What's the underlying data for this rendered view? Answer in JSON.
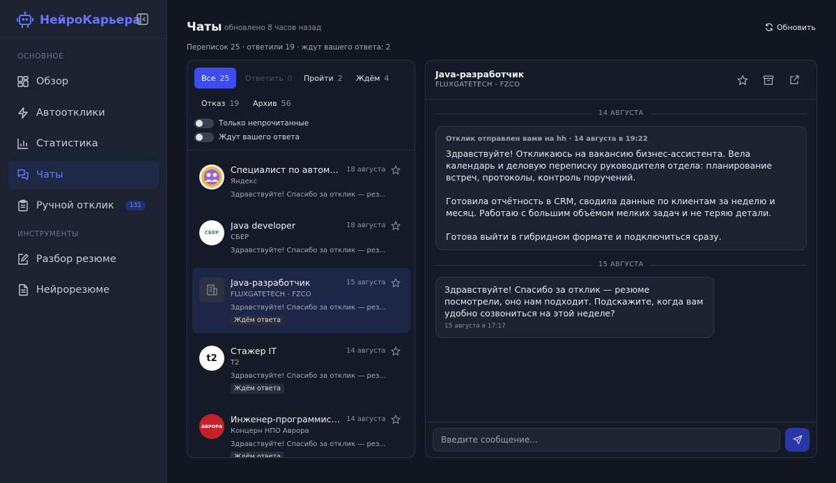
{
  "brand": {
    "name": "НейроКарьера",
    "logo_icon": "robot-icon"
  },
  "sidebar": {
    "section_main": "ОСНОВНОЕ",
    "section_tools": "ИНСТРУМЕНТЫ",
    "items": [
      {
        "label": "Обзор",
        "icon": "dashboard-icon"
      },
      {
        "label": "Автоотклики",
        "icon": "lightning-icon"
      },
      {
        "label": "Статистика",
        "icon": "bar-chart-icon"
      },
      {
        "label": "Чаты",
        "icon": "chat-icon",
        "active": true
      },
      {
        "label": "Ручной отклик",
        "icon": "clipboard-icon",
        "badge": "131"
      },
      {
        "label": "Разбор резюме",
        "icon": "pen-icon"
      },
      {
        "label": "Нейрорезюме",
        "icon": "document-icon"
      }
    ]
  },
  "header": {
    "title": "Чаты",
    "updated": "обновлено 8 часов назад",
    "stats": "Переписок 25 · ответили 19 · ждут вашего ответа: 2",
    "refresh_label": "Обновить"
  },
  "filters": {
    "tabs": [
      {
        "label": "Все",
        "count": "25",
        "active": true
      },
      {
        "label": "Ответить",
        "count": "0",
        "disabled": true
      },
      {
        "label": "Пройти",
        "count": "2"
      },
      {
        "label": "Ждём",
        "count": "4"
      },
      {
        "label": "Отказ",
        "count": "19"
      },
      {
        "label": "Архив",
        "count": "56"
      }
    ],
    "toggle_unread": "Только непрочитанные",
    "toggle_waiting": "Ждут вашего ответа"
  },
  "chats": [
    {
      "title": "Специалист по автоматизации",
      "company": "Яндекс",
      "date": "18 августа",
      "preview": "Здравствуйте! Спасибо за отклик — рез...",
      "badge": ""
    },
    {
      "title": "Java developer",
      "company": "СБЕР",
      "date": "18 августа",
      "preview": "Здравствуйте! Спасибо за отклик — рез...",
      "badge": "",
      "avatar_text": "СБЕР"
    },
    {
      "title": "Java-разработчик",
      "company": "FLUXGATETECH - FZCO",
      "date": "15 августа",
      "preview": "Здравствуйте! Спасибо за отклик — рез...",
      "badge": "Ждём ответа",
      "selected": true
    },
    {
      "title": "Стажер IT",
      "company": "Т2",
      "date": "14 августа",
      "preview": "Здравствуйте! Спасибо за отклик — рез...",
      "badge": "Ждём ответа",
      "avatar_text": "t2"
    },
    {
      "title": "Инженер-программист ...",
      "company": "Концерн НПО Аврора",
      "date": "14 августа",
      "preview": "Здравствуйте! Спасибо за отклик — рез...",
      "badge": "Ждём ответа",
      "avatar_text": "АВРОРА"
    }
  ],
  "conversation": {
    "title": "Java-разработчик",
    "company": "FLUXGATETECH - FZCO",
    "actions": [
      "star-icon",
      "archive-icon",
      "external-link-icon"
    ],
    "date_1": "14 АВГУСТА",
    "date_2": "15 АВГУСТА",
    "sent_meta": "Отклик отправлен вами на hh · 14 августа в 19:22",
    "sent_text": "Здравствуйте! Откликаюсь на вакансию бизнес-ассистента. Вела календарь и деловую переписку руководителя отдела: планирование встреч, протоколы, контроль поручений.\n\nГотовила отчётность в CRM, сводила данные по клиентам за неделю и месяц. Работаю с большим объёмом мелких задач и не теряю детали.\n\nГотова выйти в гибридном формате и подключиться сразу.",
    "reply_text": "Здравствуйте! Спасибо за отклик — резюме посмотрели, оно нам подходит. Подскажите, когда вам удобно созвониться на этой неделе?",
    "reply_time": "15 августа в 17:17",
    "input_placeholder": "Введите сообщение..."
  },
  "colors": {
    "accent": "#3b4cf0",
    "brand": "#6b73ff",
    "background": "#111621"
  }
}
